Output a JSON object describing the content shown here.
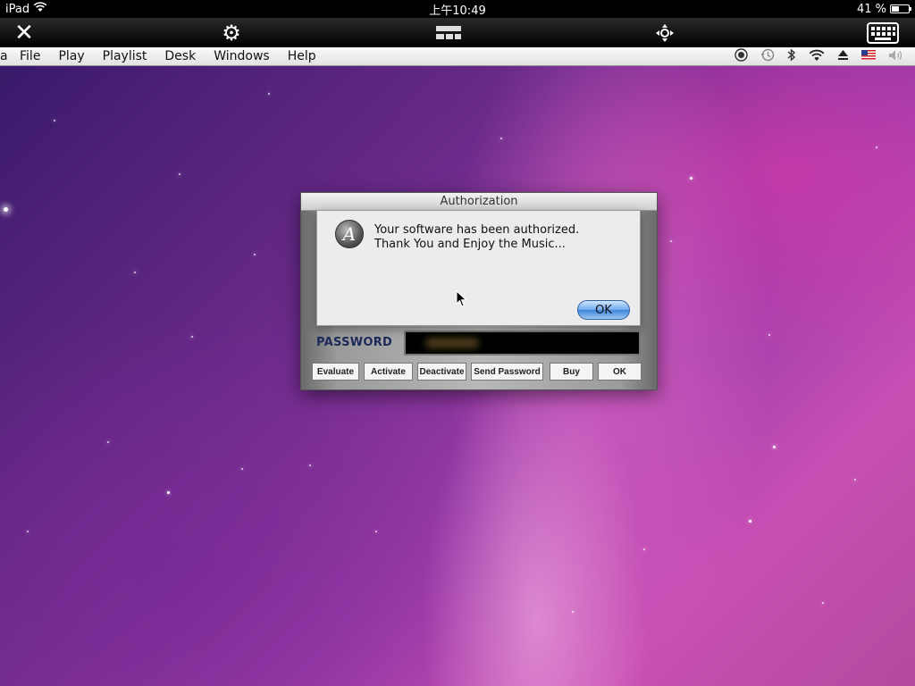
{
  "status_bar": {
    "device": "iPad",
    "time": "上午10:49",
    "battery": "41 %"
  },
  "menu": {
    "items": [
      "File",
      "Play",
      "Playlist",
      "Desk",
      "Windows",
      "Help"
    ]
  },
  "auth_window": {
    "title": "Authorization",
    "password_label": "PASSWORD",
    "buttons": [
      "Evaluate",
      "Activate",
      "Deactivate",
      "Send Password",
      "Buy",
      "OK"
    ]
  },
  "alert": {
    "line1": "Your software has been authorized.",
    "line2": "Thank You and Enjoy the Music...",
    "ok_label": "OK",
    "icon_letter": "A"
  }
}
